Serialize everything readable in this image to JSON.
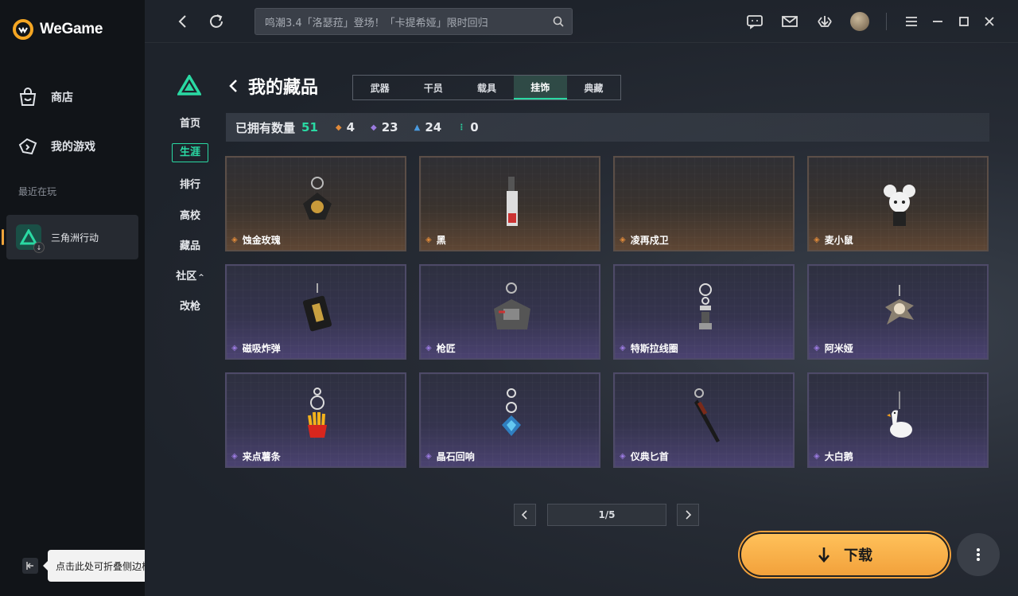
{
  "app": {
    "name": "WeGame"
  },
  "sidebar": {
    "items": [
      {
        "label": "商店",
        "icon": "bag-icon"
      },
      {
        "label": "我的游戏",
        "icon": "gamepad-icon"
      }
    ],
    "recent_label": "最近在玩",
    "recent_game": "三角洲行动",
    "collapse_tooltip": "点击此处可折叠侧边栏"
  },
  "topbar": {
    "search_text": "鸣潮3.4「洛瑟菈」登场！「卡提希娅」限时回归"
  },
  "game_nav": [
    "首页",
    "生涯",
    "排行",
    "高校",
    "藏品",
    "社区",
    "改枪"
  ],
  "game_nav_active": 1,
  "game_nav_expand_marker": "^",
  "page": {
    "title": "我的藏品",
    "tabs": [
      "武器",
      "干员",
      "载具",
      "挂饰",
      "典藏"
    ],
    "active_tab": 3,
    "owned_label": "已拥有数量",
    "owned_total": "51",
    "rarity_counts": [
      {
        "count": "4",
        "color": "#e08a3a",
        "glyph": "◆"
      },
      {
        "count": "23",
        "color": "#9b7be0",
        "glyph": "◆"
      },
      {
        "count": "24",
        "color": "#4a9be0",
        "glyph": "▲"
      },
      {
        "count": "0",
        "color": "#2ad9a3",
        "glyph": "⋮"
      }
    ]
  },
  "items": [
    {
      "name": "蚀金玫瑰",
      "rarity": "gold"
    },
    {
      "name": "黑",
      "rarity": "gold"
    },
    {
      "name": "凌再戍卫",
      "rarity": "gold"
    },
    {
      "name": "麦小鼠",
      "rarity": "gold"
    },
    {
      "name": "磁吸炸弹",
      "rarity": "purple"
    },
    {
      "name": "枪匠",
      "rarity": "purple"
    },
    {
      "name": "特斯拉线圈",
      "rarity": "purple"
    },
    {
      "name": "阿米娅",
      "rarity": "purple"
    },
    {
      "name": "来点薯条",
      "rarity": "purple"
    },
    {
      "name": "晶石回响",
      "rarity": "purple"
    },
    {
      "name": "仪典匕首",
      "rarity": "purple"
    },
    {
      "name": "大白鹅",
      "rarity": "purple"
    }
  ],
  "pagination": {
    "label": "1/5"
  },
  "download": {
    "label": "下载"
  },
  "colors": {
    "accent": "#2ad9a3",
    "gold_gem": "#e08a3a",
    "purple_gem": "#9b7be0",
    "download": "#f7b04a"
  }
}
